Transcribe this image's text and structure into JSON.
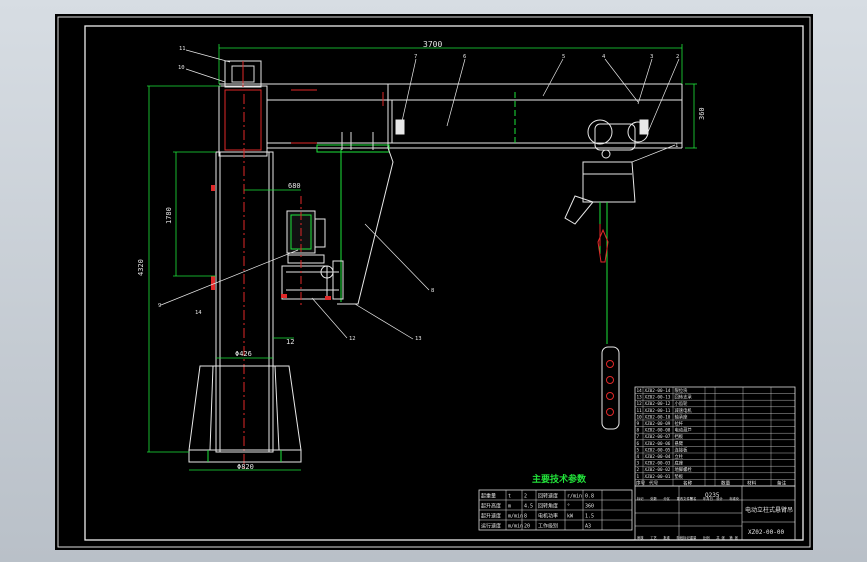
{
  "drawing": {
    "overall_width_dim": "3700",
    "arm_height_dim": "360",
    "column_height_dim": "4320",
    "inner_height_dim": "1780",
    "gear_offset_dim": "680",
    "wall_thickness_dim": "12",
    "column_dia_dim": "Φ426",
    "base_dia_dim": "Φ820",
    "balloon_labels": [
      "11",
      "10",
      "7",
      "6",
      "5",
      "4",
      "3",
      "2",
      "1",
      "8",
      "9",
      "12",
      "13",
      "14"
    ]
  },
  "tech_table": {
    "title": "主要技术参数",
    "rows": [
      [
        "起重量",
        "t",
        "2",
        "回转速度",
        "r/min",
        "0.8"
      ],
      [
        "起升高度",
        "m",
        "4.5",
        "回转角度",
        "°",
        "360"
      ],
      [
        "起升速度",
        "m/min",
        "8",
        "电机功率",
        "kW",
        "1.5"
      ],
      [
        "运行速度",
        "m/min",
        "20",
        "工作级别",
        "",
        "A3"
      ]
    ]
  },
  "parts_list": {
    "rows": [
      [
        "14",
        "XZ02-00-14",
        "限位块"
      ],
      [
        "13",
        "XZ02-00-13",
        "回转支承"
      ],
      [
        "12",
        "XZ02-00-12",
        "小齿轮"
      ],
      [
        "11",
        "XZ02-00-11",
        "减速电机"
      ],
      [
        "10",
        "XZ02-00-10",
        "轴承座"
      ],
      [
        "9",
        "XZ02-00-09",
        "拉杆"
      ],
      [
        "8",
        "XZ02-00-08",
        "电动葫芦"
      ],
      [
        "7",
        "XZ02-00-07",
        "挡板"
      ],
      [
        "6",
        "XZ02-00-06",
        "悬臂"
      ],
      [
        "5",
        "XZ02-00-05",
        "连接板"
      ],
      [
        "4",
        "XZ02-00-04",
        "立柱"
      ],
      [
        "3",
        "XZ02-00-03",
        "底座"
      ],
      [
        "2",
        "XZ02-00-02",
        "地脚螺栓"
      ],
      [
        "1",
        "XZ02-00-01",
        "垫板"
      ]
    ],
    "header": [
      "序号",
      "代号",
      "名称",
      "数量",
      "材料",
      "备注"
    ]
  },
  "title_block": {
    "material": "Q235",
    "name": "电动立柱式悬臂吊",
    "drawing_no": "XZ02-00-00",
    "labels": [
      "标记",
      "处数",
      "分区",
      "更改文件号",
      "签名",
      "年月日",
      "设计",
      "标准化",
      "审核",
      "工艺",
      "批准",
      "阶段标记",
      "重量",
      "比例",
      "共 张",
      "第 张"
    ]
  }
}
